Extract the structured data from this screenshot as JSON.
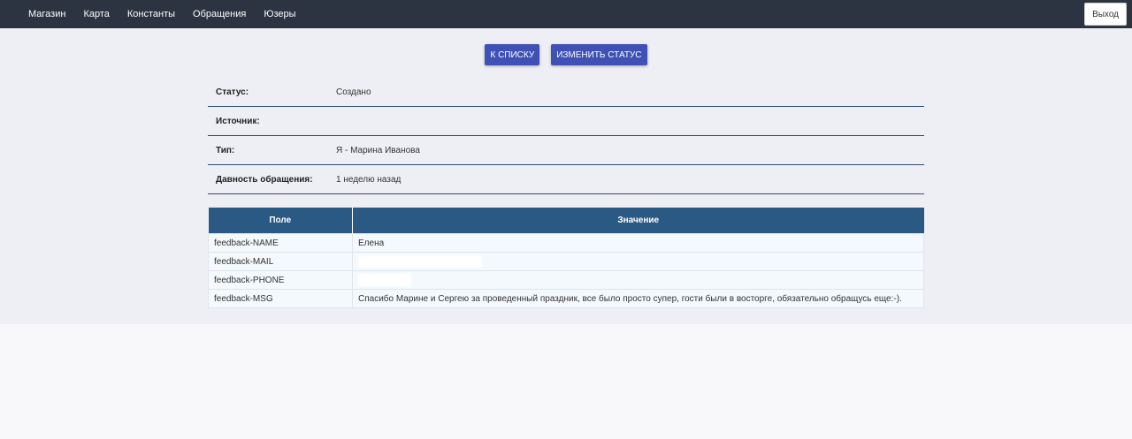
{
  "nav": {
    "items": [
      "Магазин",
      "Карта",
      "Константы",
      "Обращения",
      "Юзеры"
    ],
    "logout_label": "Выход"
  },
  "actions": {
    "back_label": "К СПИСКУ",
    "change_status_label": "ИЗМЕНИТЬ СТАТУС"
  },
  "info": [
    {
      "label": "Статус:",
      "value": "Создано"
    },
    {
      "label": "Источник:",
      "value": ""
    },
    {
      "label": "Тип:",
      "value": "Я - Марина Иванова"
    },
    {
      "label": "Давность обращения:",
      "value": "1 неделю назад"
    }
  ],
  "fields_table": {
    "headers": [
      "Поле",
      "Значение"
    ],
    "rows": [
      {
        "field": "feedback-NAME",
        "value": "Елена"
      },
      {
        "field": "feedback-MAIL",
        "value": ""
      },
      {
        "field": "feedback-PHONE",
        "value": ""
      },
      {
        "field": "feedback-MSG",
        "value": "Спасибо Марине и Сергею за проведенный праздник, все было просто супер, гости были в восторге, обязательно обращусь еще:-)."
      }
    ]
  },
  "colors": {
    "topbar": "#2b3440",
    "button": "#3f51b5",
    "table_header": "#2a5a83"
  }
}
